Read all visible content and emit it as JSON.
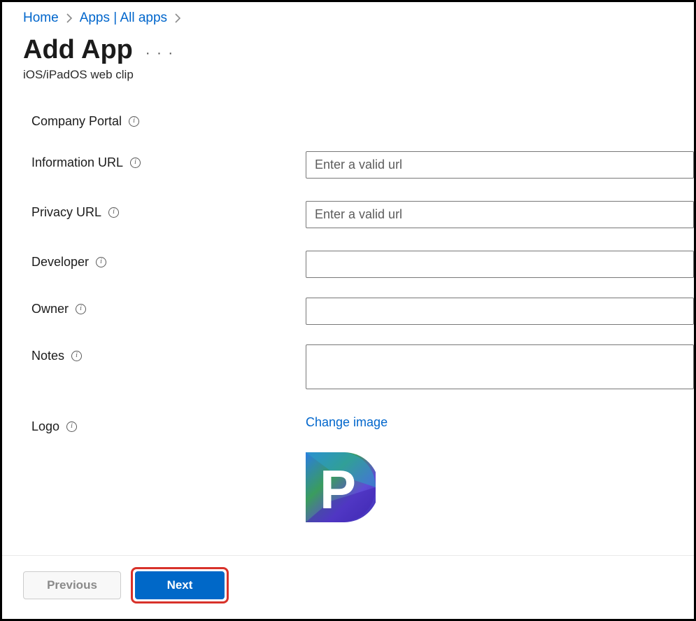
{
  "breadcrumb": {
    "home": "Home",
    "apps": "Apps | All apps"
  },
  "header": {
    "title": "Add App",
    "subtitle": "iOS/iPadOS web clip"
  },
  "form": {
    "company_portal": {
      "label": "Company Portal"
    },
    "info_url": {
      "label": "Information URL",
      "placeholder": "Enter a valid url",
      "value": ""
    },
    "privacy_url": {
      "label": "Privacy URL",
      "placeholder": "Enter a valid url",
      "value": ""
    },
    "developer": {
      "label": "Developer",
      "value": ""
    },
    "owner": {
      "label": "Owner",
      "value": ""
    },
    "notes": {
      "label": "Notes",
      "value": ""
    },
    "logo": {
      "label": "Logo",
      "change_label": "Change image"
    }
  },
  "footer": {
    "previous": "Previous",
    "next": "Next"
  },
  "colors": {
    "accent": "#0066cc",
    "primary_button": "#0068c8",
    "highlight_border": "#d8322a"
  }
}
